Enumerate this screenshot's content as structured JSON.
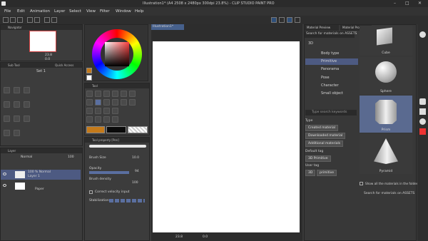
{
  "window": {
    "title": "Illustration1* (A4 2508 x 2480px 300dpi 23.8%) - CLIP STUDIO PAINT PRO",
    "minimize": "–",
    "maximize": "□",
    "close": "✕"
  },
  "menu": [
    "File",
    "Edit",
    "Animation",
    "Layer",
    "Select",
    "View",
    "Filter",
    "Window",
    "Help"
  ],
  "navigator": {
    "title": "Navigator",
    "zoom": "23.8",
    "angle": "0.0"
  },
  "sub_tool": {
    "title": "Sub Tool",
    "set": "Set 1"
  },
  "quick_access": {
    "title": "Quick Access"
  },
  "layer": {
    "title": "Layer",
    "blend_mode": "Normal",
    "opacity": "100",
    "layers": [
      {
        "percent": "100 %",
        "mode": "Normal",
        "name": "Layer 1"
      },
      {
        "name": "Paper"
      }
    ]
  },
  "color": {
    "swatch_fg": "#c47a1a",
    "swatch_bg": "#0a0a0a"
  },
  "tool": {
    "title": "Tool"
  },
  "tool_property": {
    "title": "Tool property [Pen]",
    "brush_size_label": "Brush Size",
    "brush_size_value": "10.0",
    "opacity_label": "Opacity",
    "opacity_value": "94",
    "brush_density_label": "Brush density",
    "brush_density_value": "100",
    "correct_velocity_label": "Correct velocity input",
    "stabilization_label": "Stabilization"
  },
  "canvas": {
    "tab": "Illustration1*",
    "status_zoom": "23.8",
    "status_angle": "0.0"
  },
  "material": {
    "tabs": [
      "Material Preview",
      "Material Prop"
    ],
    "search_placeholder": "Search for materials on ASSETS",
    "tree": [
      "3D",
      "Body type",
      "Primitive",
      "Panorama",
      "Pose",
      "Character",
      "Small object"
    ],
    "tag_search_placeholder": "Type search keywords",
    "type_label": "Type",
    "type_buttons": [
      "Created material",
      "Downloaded material",
      "Additional materials"
    ],
    "default_tag_label": "Default tag",
    "default_tag_buttons": [
      "3D Primitive"
    ],
    "user_tag_label": "User tag",
    "user_tag_buttons": [
      "3D",
      "primitive"
    ],
    "show_all_label": "Show all the materials in the folder",
    "assets_search_label": "Search for materials on ASSETS",
    "assets": [
      "Cube",
      "Sphere",
      "Prism",
      "Pyramid"
    ]
  }
}
